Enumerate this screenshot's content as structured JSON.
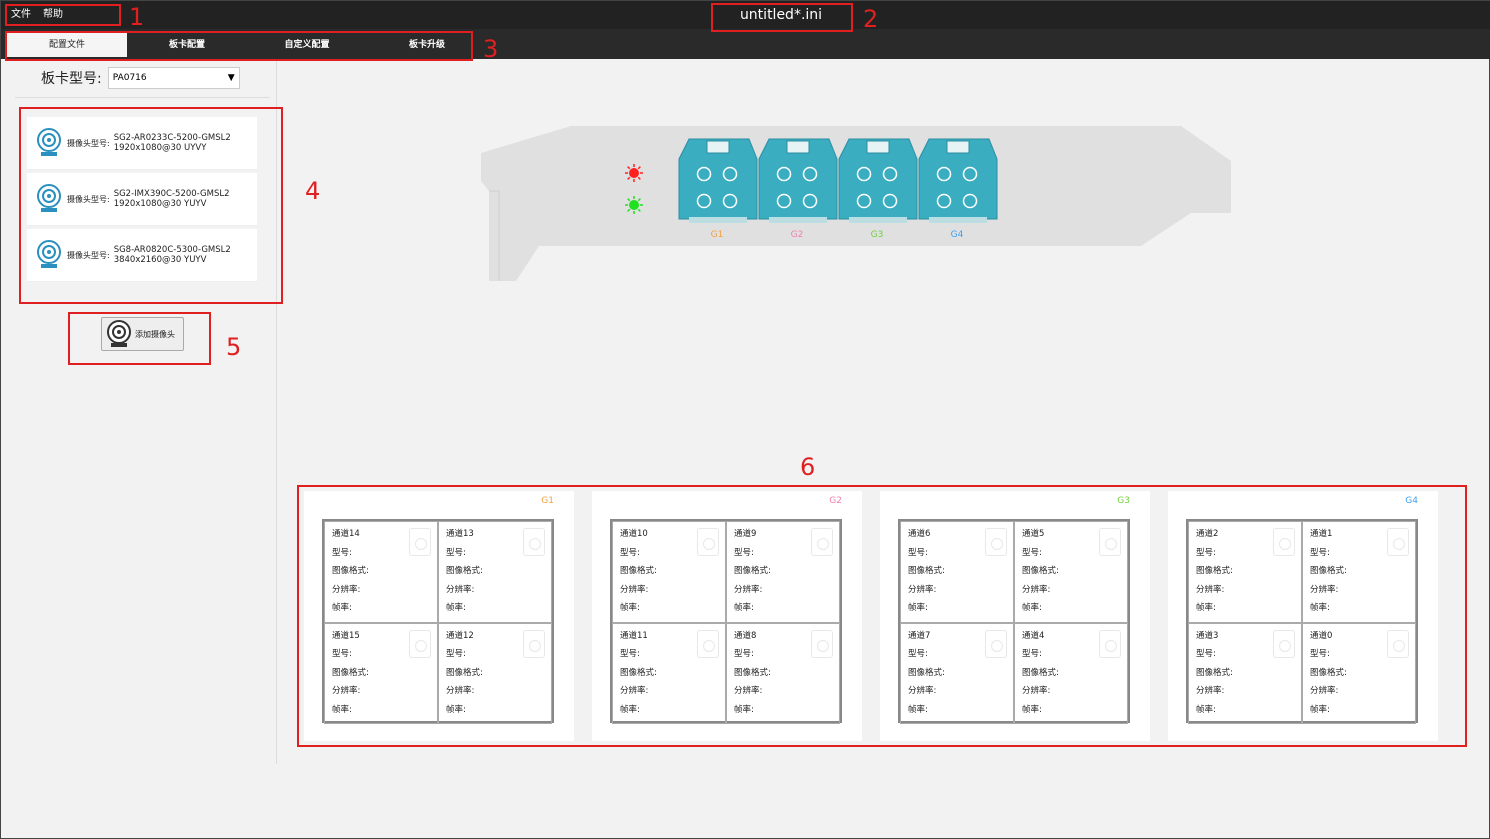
{
  "menu": {
    "items": [
      "文件",
      "帮助"
    ]
  },
  "window": {
    "title": "untitled*.ini"
  },
  "tabs": [
    {
      "label": "配置文件",
      "active": true
    },
    {
      "label": "板卡配置",
      "active": false
    },
    {
      "label": "自定义配置",
      "active": false
    },
    {
      "label": "板卡升级",
      "active": false
    }
  ],
  "board_model": {
    "label": "板卡型号:",
    "value": "PA0716"
  },
  "cameras": [
    {
      "kind_label": "摄像头型号:",
      "model": "SG2-AR0233C-5200-GMSL2",
      "format": "1920x1080@30 UYVY"
    },
    {
      "kind_label": "摄像头型号:",
      "model": "SG2-IMX390C-5200-GMSL2",
      "format": "1920x1080@30 YUYV"
    },
    {
      "kind_label": "摄像头型号:",
      "model": "SG8-AR0820C-5300-GMSL2",
      "format": "3840x2160@30 YUYV"
    }
  ],
  "add_camera_button": {
    "label": "添加摄像头"
  },
  "board": {
    "leds": [
      {
        "color": "#ff2020"
      },
      {
        "color": "#20e020"
      }
    ],
    "ports": [
      {
        "label": "G1",
        "color": "#f0a040"
      },
      {
        "label": "G2",
        "color": "#f080b0"
      },
      {
        "label": "G3",
        "color": "#70d040"
      },
      {
        "label": "G4",
        "color": "#40a0f0"
      }
    ]
  },
  "field_labels": {
    "model": "型号:",
    "format": "图像格式:",
    "resolution": "分辨率:",
    "fps": "帧率:"
  },
  "groups": [
    {
      "label": "G1",
      "color": "#f0a040",
      "channels": [
        "通道14",
        "通道13",
        "通道15",
        "通道12"
      ]
    },
    {
      "label": "G2",
      "color": "#f080b0",
      "channels": [
        "通道10",
        "通道9",
        "通道11",
        "通道8"
      ]
    },
    {
      "label": "G3",
      "color": "#70d040",
      "channels": [
        "通道6",
        "通道5",
        "通道7",
        "通道4"
      ]
    },
    {
      "label": "G4",
      "color": "#40a0f0",
      "channels": [
        "通道2",
        "通道1",
        "通道3",
        "通道0"
      ]
    }
  ],
  "annotations": [
    "1",
    "2",
    "3",
    "4",
    "5",
    "6"
  ],
  "colors": {
    "annotation": "#e02020",
    "port_teal": "#3aaec0",
    "titlebar": "#222222"
  }
}
